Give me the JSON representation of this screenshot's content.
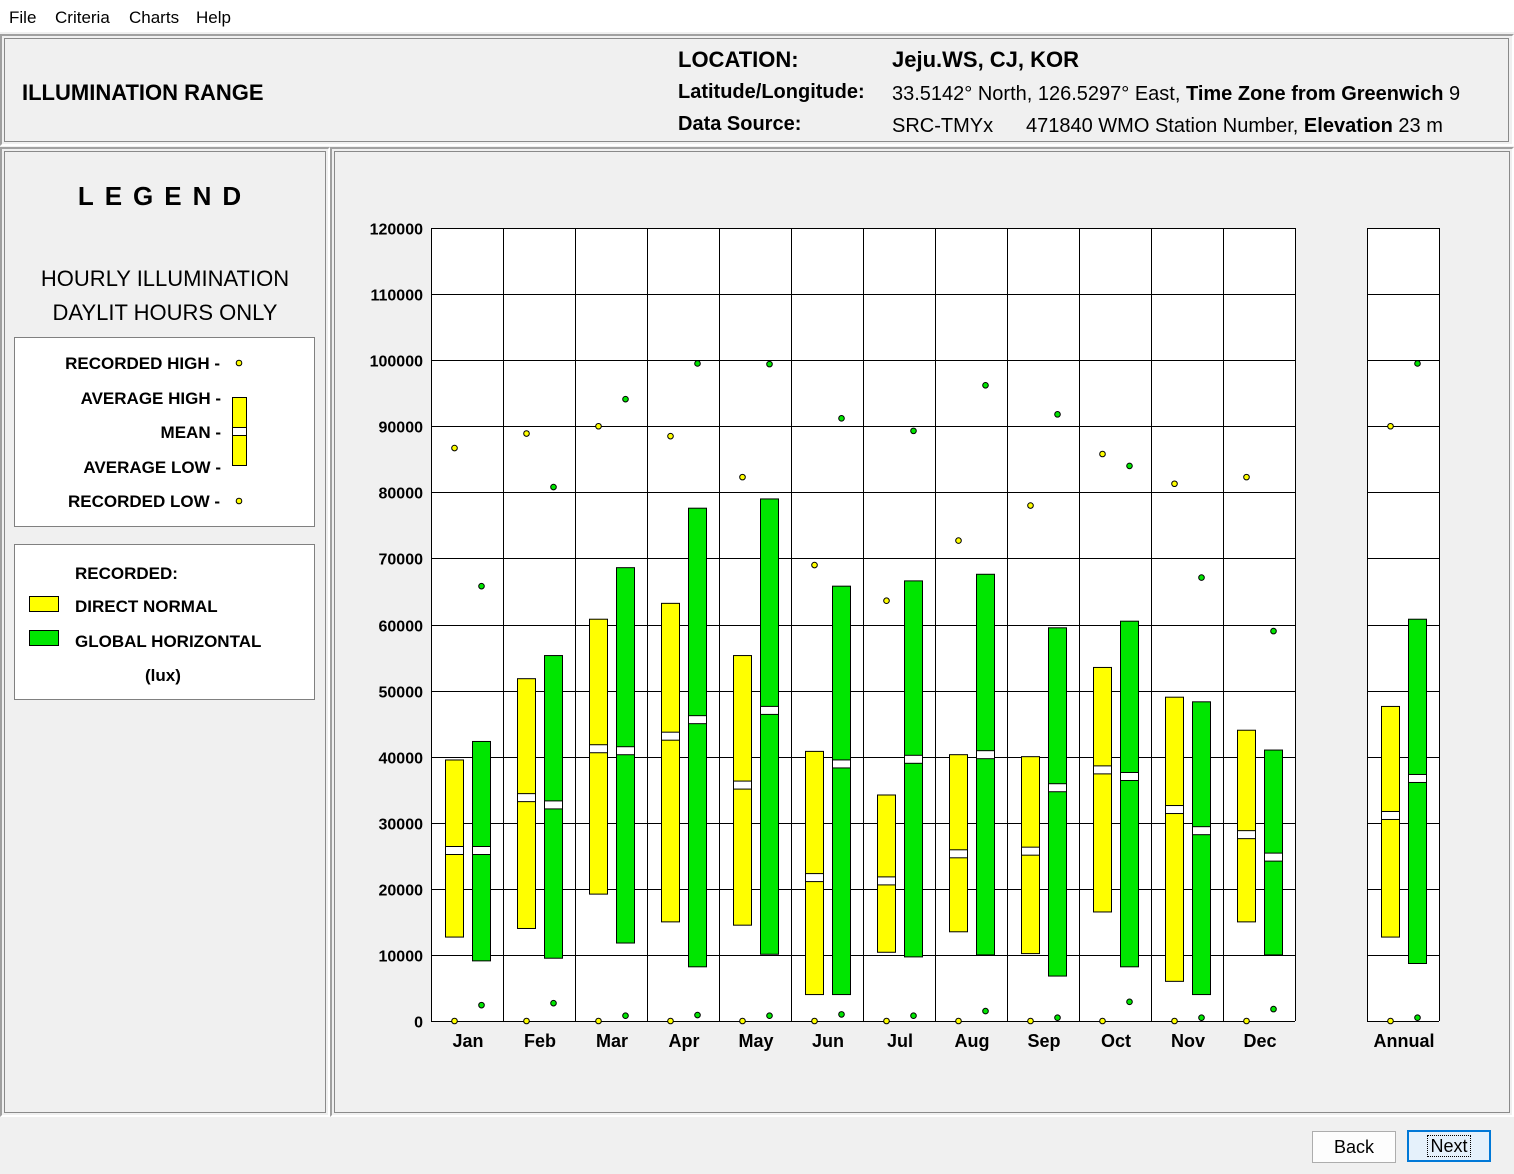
{
  "menu": [
    "File",
    "Criteria",
    "Charts",
    "Help"
  ],
  "header": {
    "title": "ILLUMINATION RANGE",
    "location_label": "LOCATION:",
    "location_value": "Jeju.WS, CJ, KOR",
    "latlon_label": "Latitude/Longitude:",
    "latlon_value": "33.5142° North, 126.5297° East,",
    "tz_label": "Time Zone from Greenwich",
    "tz_value": "9",
    "source_label": "Data Source:",
    "source_value": "SRC-TMYx",
    "station_value": "471840 WMO Station Number,",
    "elev_label": "Elevation",
    "elev_value": "23 m"
  },
  "legend": {
    "title": "LEGEND",
    "sub1": "HOURLY ILLUMINATION",
    "sub2": "DAYLIT HOURS ONLY",
    "recorded_high": "RECORDED HIGH -",
    "average_high": "AVERAGE HIGH -",
    "mean": "MEAN -",
    "average_low": "AVERAGE LOW -",
    "recorded_low": "RECORDED LOW -",
    "recorded": "RECORDED:",
    "direct_normal": "DIRECT NORMAL",
    "global_horizontal": "GLOBAL HORIZONTAL",
    "unit": "(lux)",
    "colors": {
      "direct_normal": "#ffff00",
      "global_horizontal": "#00e600"
    }
  },
  "buttons": {
    "back": "Back",
    "next": "Next"
  },
  "chart_data": {
    "type": "range-bar",
    "ylim": [
      0,
      120000
    ],
    "yticks": [
      0,
      10000,
      20000,
      30000,
      40000,
      50000,
      60000,
      70000,
      80000,
      90000,
      100000,
      110000,
      120000
    ],
    "categories": [
      "Jan",
      "Feb",
      "Mar",
      "Apr",
      "May",
      "Jun",
      "Jul",
      "Aug",
      "Sep",
      "Oct",
      "Nov",
      "Dec",
      "Annual"
    ],
    "series": [
      {
        "name": "DIRECT NORMAL",
        "color": "#ffff00",
        "recorded_high": [
          86700,
          88900,
          90000,
          88500,
          82300,
          69000,
          63600,
          72700,
          78000,
          85800,
          81300,
          82300,
          90000
        ],
        "average_high": [
          39500,
          51800,
          60800,
          63200,
          55300,
          40800,
          34200,
          40300,
          40000,
          53500,
          49000,
          44000,
          47600
        ],
        "mean": [
          25800,
          33800,
          41200,
          43100,
          35700,
          21700,
          21200,
          25300,
          25700,
          38000,
          32000,
          28200,
          31100
        ],
        "average_low": [
          12700,
          14000,
          19200,
          15000,
          14500,
          4000,
          10400,
          13500,
          10200,
          16500,
          6000,
          15000,
          12700
        ],
        "recorded_low": [
          0,
          0,
          0,
          0,
          0,
          0,
          0,
          0,
          0,
          0,
          0,
          0,
          0
        ]
      },
      {
        "name": "GLOBAL HORIZONTAL",
        "color": "#00e600",
        "recorded_high": [
          65800,
          80800,
          94100,
          99500,
          99400,
          91200,
          89300,
          96200,
          91800,
          84000,
          67100,
          59000,
          99500
        ],
        "average_high": [
          42300,
          55300,
          68600,
          77600,
          79000,
          65800,
          66600,
          67600,
          59500,
          60500,
          48300,
          41000,
          60800
        ],
        "mean": [
          25800,
          32700,
          40900,
          45600,
          47000,
          38900,
          39600,
          40300,
          35300,
          37000,
          28800,
          24800,
          36700
        ],
        "average_low": [
          9100,
          9500,
          11800,
          8200,
          10100,
          4000,
          9700,
          10000,
          6800,
          8200,
          4000,
          10000,
          8700
        ],
        "recorded_low": [
          2400,
          2700,
          800,
          900,
          800,
          1000,
          800,
          1500,
          500,
          2900,
          500,
          1800,
          500
        ]
      }
    ]
  }
}
